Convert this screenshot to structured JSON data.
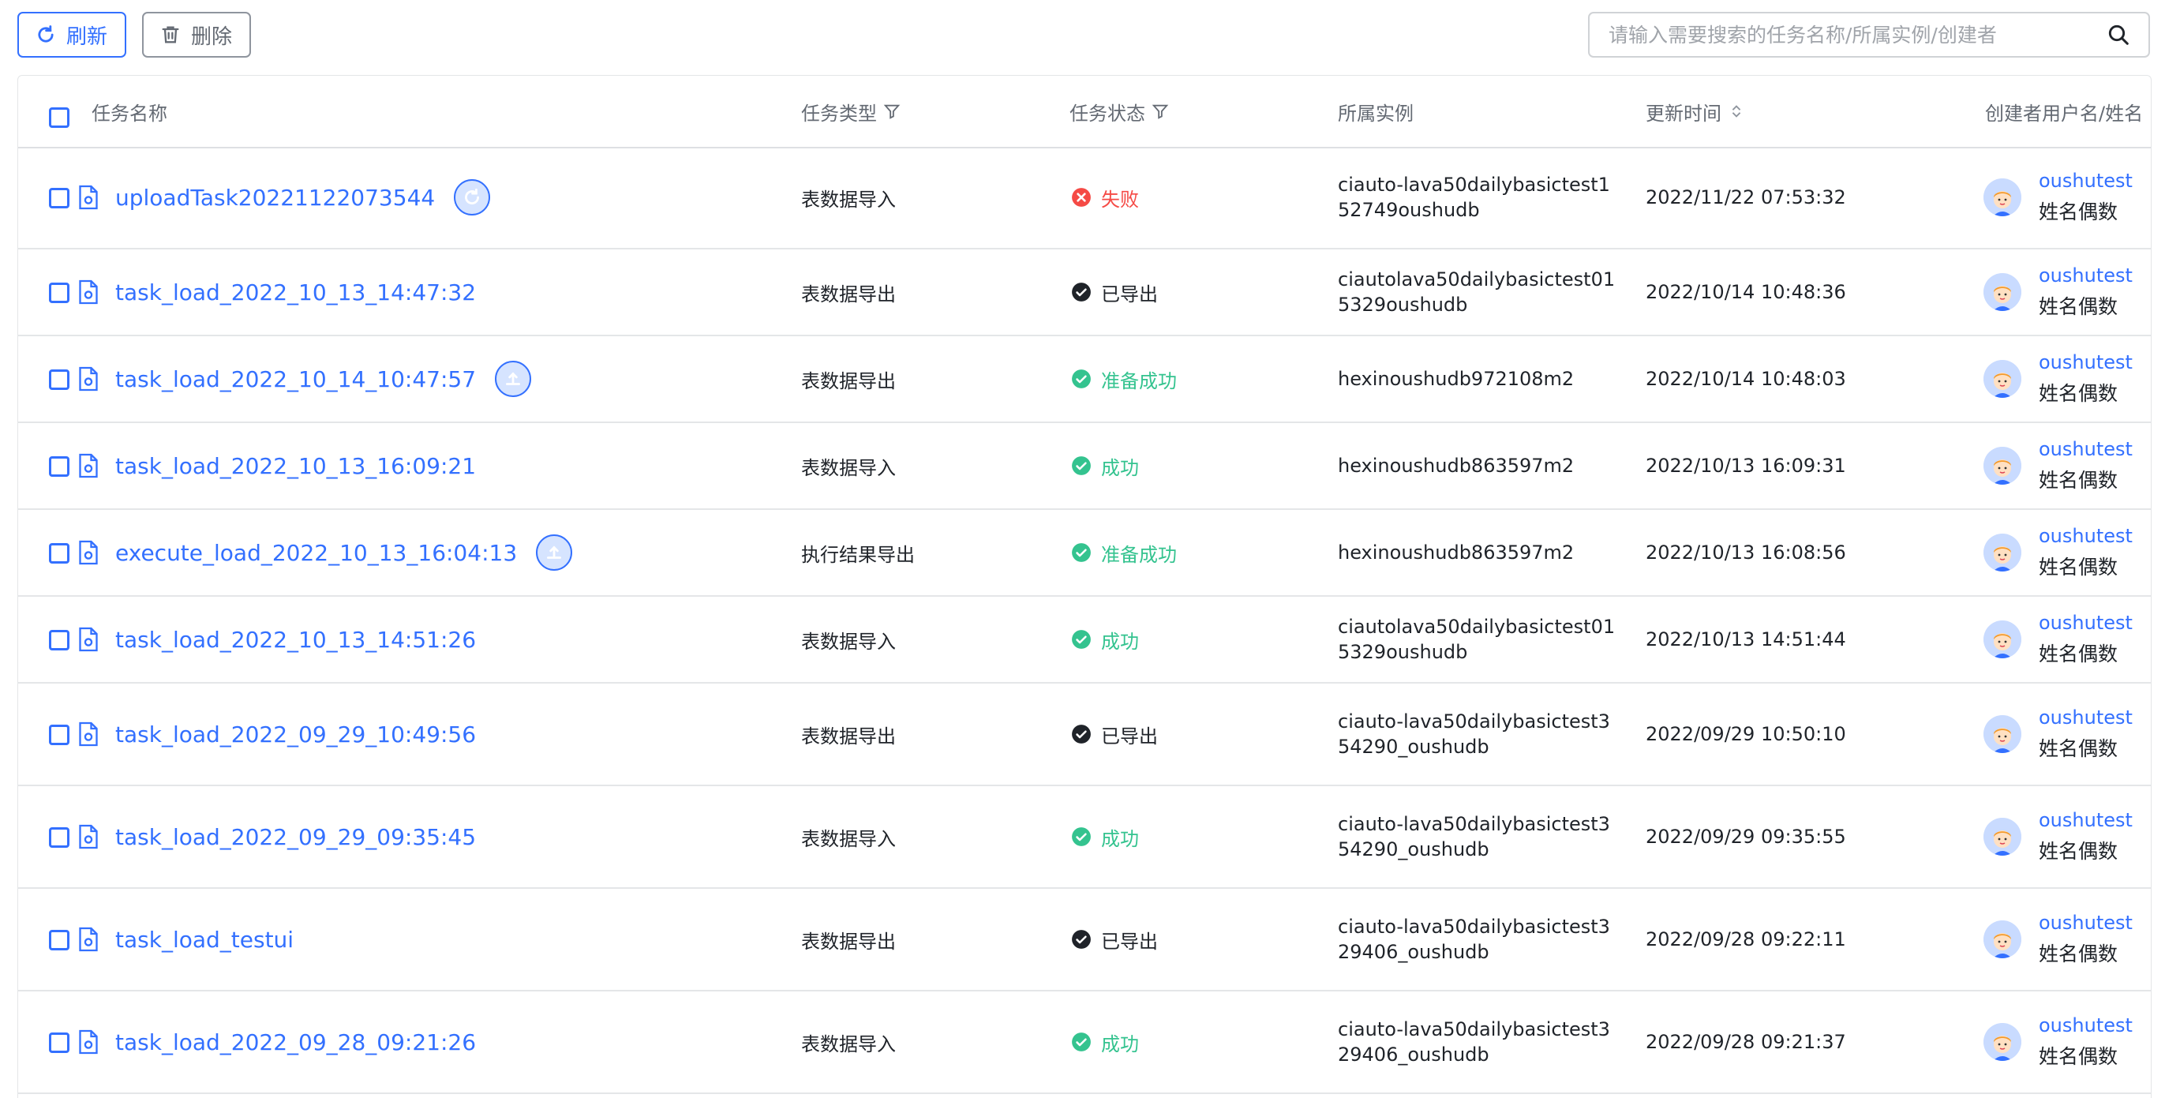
{
  "toolbar": {
    "refresh_label": "刷新",
    "delete_label": "删除",
    "search_placeholder": "请输入需要搜索的任务名称/所属实例/创建者"
  },
  "table": {
    "columns": {
      "name": "任务名称",
      "type": "任务类型",
      "status": "任务状态",
      "instance": "所属实例",
      "updated": "更新时间",
      "creator": "创建者用户名/姓名"
    },
    "rows": [
      {
        "name": "uploadTask20221122073544",
        "action": "refresh",
        "type": "表数据导入",
        "status": "失败",
        "status_kind": "failed",
        "instance": "ciauto-lava50dailybasictest152749oushudb",
        "updated": "2022/11/22 07:53:32",
        "creator_id": "oushutest",
        "creator_name": "姓名偶数"
      },
      {
        "name": "task_load_2022_10_13_14:47:32",
        "action": "",
        "type": "表数据导出",
        "status": "已导出",
        "status_kind": "exported",
        "instance": "ciautolava50dailybasictest015329oushudb",
        "updated": "2022/10/14 10:48:36",
        "creator_id": "oushutest",
        "creator_name": "姓名偶数"
      },
      {
        "name": "task_load_2022_10_14_10:47:57",
        "action": "export",
        "type": "表数据导出",
        "status": "准备成功",
        "status_kind": "success",
        "instance": "hexinoushudb972108m2",
        "updated": "2022/10/14 10:48:03",
        "creator_id": "oushutest",
        "creator_name": "姓名偶数"
      },
      {
        "name": "task_load_2022_10_13_16:09:21",
        "action": "",
        "type": "表数据导入",
        "status": "成功",
        "status_kind": "success",
        "instance": "hexinoushudb863597m2",
        "updated": "2022/10/13 16:09:31",
        "creator_id": "oushutest",
        "creator_name": "姓名偶数"
      },
      {
        "name": "execute_load_2022_10_13_16:04:13",
        "action": "export",
        "type": "执行结果导出",
        "status": "准备成功",
        "status_kind": "success",
        "instance": "hexinoushudb863597m2",
        "updated": "2022/10/13 16:08:56",
        "creator_id": "oushutest",
        "creator_name": "姓名偶数"
      },
      {
        "name": "task_load_2022_10_13_14:51:26",
        "action": "",
        "type": "表数据导入",
        "status": "成功",
        "status_kind": "success",
        "instance": "ciautolava50dailybasictest015329oushudb",
        "updated": "2022/10/13 14:51:44",
        "creator_id": "oushutest",
        "creator_name": "姓名偶数"
      },
      {
        "name": "task_load_2022_09_29_10:49:56",
        "action": "",
        "type": "表数据导出",
        "status": "已导出",
        "status_kind": "exported",
        "instance": "ciauto-lava50dailybasictest354290_oushudb",
        "updated": "2022/09/29 10:50:10",
        "creator_id": "oushutest",
        "creator_name": "姓名偶数"
      },
      {
        "name": "task_load_2022_09_29_09:35:45",
        "action": "",
        "type": "表数据导入",
        "status": "成功",
        "status_kind": "success",
        "instance": "ciauto-lava50dailybasictest354290_oushudb",
        "updated": "2022/09/29 09:35:55",
        "creator_id": "oushutest",
        "creator_name": "姓名偶数"
      },
      {
        "name": "task_load_testui",
        "action": "",
        "type": "表数据导出",
        "status": "已导出",
        "status_kind": "exported",
        "instance": "ciauto-lava50dailybasictest329406_oushudb",
        "updated": "2022/09/28 09:22:11",
        "creator_id": "oushutest",
        "creator_name": "姓名偶数"
      },
      {
        "name": "task_load_2022_09_28_09:21:26",
        "action": "",
        "type": "表数据导入",
        "status": "成功",
        "status_kind": "success",
        "instance": "ciauto-lava50dailybasictest329406_oushudb",
        "updated": "2022/09/28 09:21:37",
        "creator_id": "oushutest",
        "creator_name": "姓名偶数"
      }
    ]
  },
  "colors": {
    "accent": "#3370ff",
    "success": "#34c38f",
    "failed": "#f54a45",
    "exported": "#1f2329"
  },
  "icons": {
    "refresh": "refresh-icon",
    "delete": "trash-icon",
    "search": "search-icon",
    "filter": "filter-icon",
    "sort": "sort-icon",
    "file": "file-icon"
  }
}
